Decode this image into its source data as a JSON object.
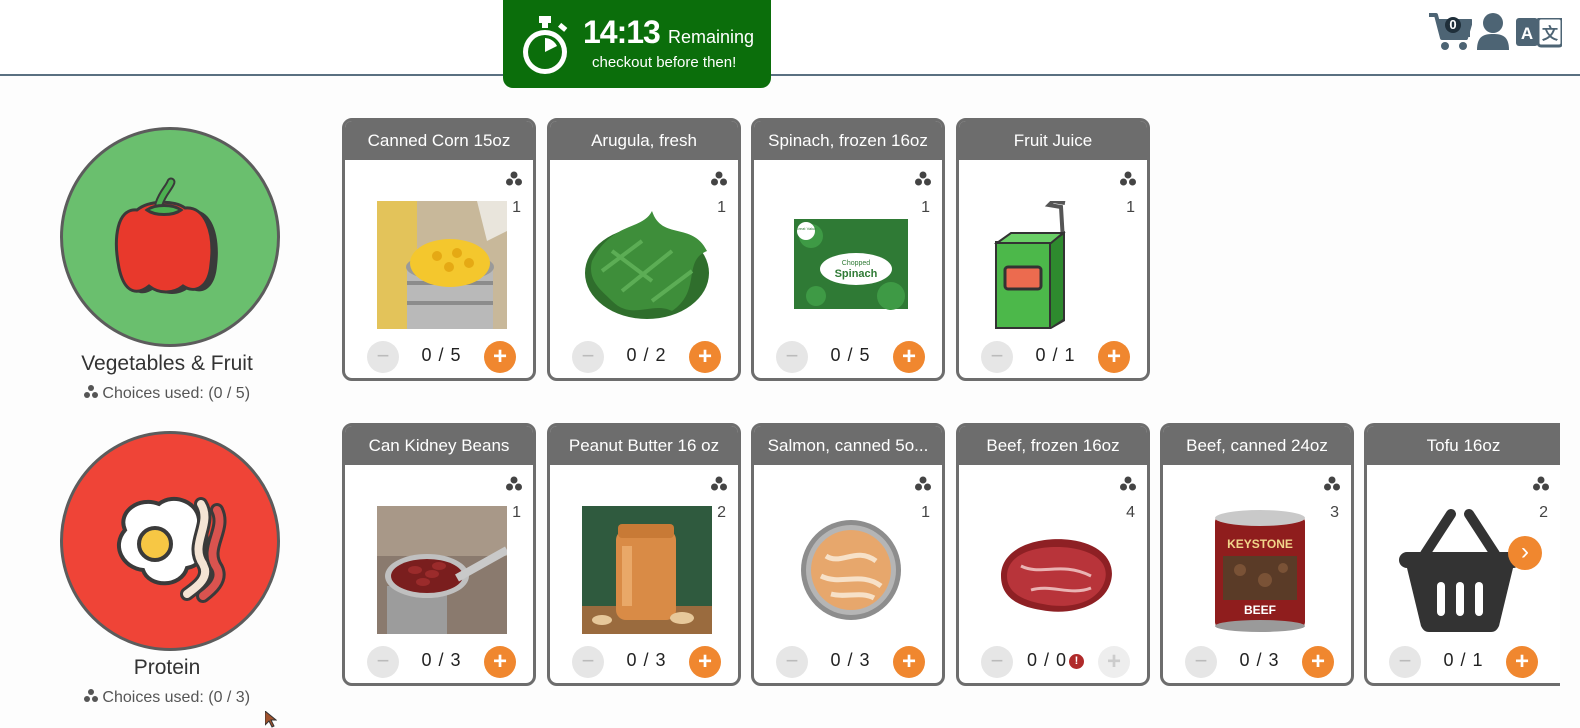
{
  "header": {
    "timer": {
      "time": "14:13",
      "remaining_label": "Remaining",
      "subtitle": "checkout before then!",
      "icon": "stopwatch-icon"
    },
    "cart_count": "0",
    "icons": [
      "cart-icon",
      "user-icon",
      "translate-icon"
    ]
  },
  "categories": [
    {
      "name": "Vegetables & Fruit",
      "used": "Choices used: (0 / 5)",
      "color": "#6abf6e",
      "icon": "bell-pepper-icon"
    },
    {
      "name": "Protein",
      "used": "Choices used: (0 / 3)",
      "color": "#ef4437",
      "icon": "egg-bacon-icon"
    }
  ],
  "rows": [
    [
      {
        "title": "Canned Corn 15oz",
        "points": "1",
        "qty": "0 / 5",
        "image": "canned-corn"
      },
      {
        "title": "Arugula, fresh",
        "points": "1",
        "qty": "0 / 2",
        "image": "arugula"
      },
      {
        "title": "Spinach, frozen 16oz",
        "points": "1",
        "qty": "0 / 5",
        "image": "spinach-package",
        "pkg_brand": "Great Value",
        "pkg_line1": "Chopped",
        "pkg_line2": "Spinach"
      },
      {
        "title": "Fruit Juice",
        "points": "1",
        "qty": "0 / 1",
        "image": "juice-box"
      }
    ],
    [
      {
        "title": "Can Kidney Beans",
        "points": "1",
        "qty": "0 / 3",
        "image": "kidney-beans"
      },
      {
        "title": "Peanut Butter 16 oz",
        "points": "2",
        "qty": "0 / 3",
        "image": "peanut-butter"
      },
      {
        "title": "Salmon, canned 5o...",
        "points": "1",
        "qty": "0 / 3",
        "image": "salmon-can"
      },
      {
        "title": "Beef, frozen 16oz",
        "points": "4",
        "qty": "0 / 0",
        "image": "beef-steak",
        "warning": "!"
      },
      {
        "title": "Beef, canned 24oz",
        "points": "3",
        "qty": "0 / 3",
        "image": "beef-can",
        "can_brand": "KEYSTONE",
        "can_label": "BEEF"
      },
      {
        "title": "Tofu 16oz",
        "points": "2",
        "qty": "0 / 1",
        "image": "basket"
      }
    ]
  ],
  "controls": {
    "minus": "−",
    "plus": "+",
    "next": "›"
  },
  "colors": {
    "accent": "#f0872f",
    "timer_bg": "#0b6e0b",
    "card_header": "#6d6d6d"
  }
}
